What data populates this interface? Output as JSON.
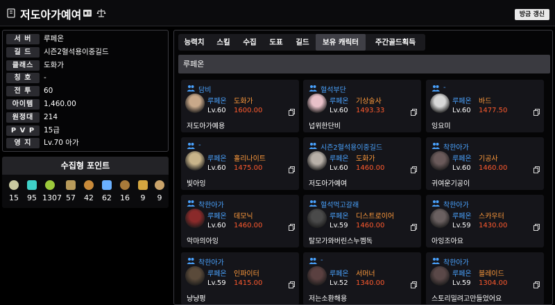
{
  "header": {
    "title": "저도아가예여",
    "refresh_label": "갱신",
    "refresh_prefix": "방금"
  },
  "info": {
    "rows": [
      {
        "key": "서 버",
        "value": "루페온"
      },
      {
        "key": "길 드",
        "value": "시즌2혈석용이중길드"
      },
      {
        "key": "클래스",
        "value": "도화가"
      },
      {
        "key": "칭 호",
        "value": "-"
      },
      {
        "key": "전 투",
        "value": "60"
      },
      {
        "key": "아이템",
        "value": "1,460.00"
      },
      {
        "key": "원정대",
        "value": "214"
      },
      {
        "key": "P V P",
        "value": "15급"
      },
      {
        "key": "영 지",
        "value": "Lv.70 아가"
      }
    ]
  },
  "collection": {
    "title": "수집형 포인트",
    "items": [
      {
        "icon": "mokoko-seed-icon",
        "value": "15",
        "color": "#c9c9a0"
      },
      {
        "icon": "island-heart-icon",
        "value": "95",
        "color": "#3fd1c8"
      },
      {
        "icon": "giant-heart-icon",
        "value": "1307",
        "color": "#9cc93b"
      },
      {
        "icon": "art-piece-icon",
        "value": "57",
        "color": "#b89a5a"
      },
      {
        "icon": "voyage-map-icon",
        "value": "42",
        "color": "#c98a3a"
      },
      {
        "icon": "igneas-token-icon",
        "value": "62",
        "color": "#6ab0ff"
      },
      {
        "icon": "world-tree-leaf-icon",
        "value": "16",
        "color": "#a87a3a"
      },
      {
        "icon": "orpheus-star-icon",
        "value": "9",
        "color": "#d4a640"
      },
      {
        "icon": "orpheus-medal-icon",
        "value": "9",
        "color": "#c9a36a"
      }
    ]
  },
  "tabs": [
    {
      "label": "능력치",
      "active": false
    },
    {
      "label": "스킬",
      "active": false
    },
    {
      "label": "수집",
      "active": false
    },
    {
      "label": "도표",
      "active": false
    },
    {
      "label": "길드",
      "active": false
    },
    {
      "label": "보유 캐릭터",
      "active": true
    },
    {
      "label": "주간골드획득",
      "active": false
    }
  ],
  "server_header": "루페온",
  "characters": [
    {
      "guild": "담비",
      "server": "루페온",
      "class": "도화가",
      "level": "Lv.60",
      "ilvl": "1600.00",
      "name": "저도아가예용",
      "avatar_color": "#c9a98a"
    },
    {
      "guild": "혈석부단",
      "server": "루페온",
      "class": "기상술사",
      "level": "Lv.60",
      "ilvl": "1493.33",
      "name": "넙위한단비",
      "avatar_color": "#e8c0c8"
    },
    {
      "guild": "-",
      "server": "루페온",
      "class": "바드",
      "level": "Lv.60",
      "ilvl": "1477.50",
      "name": "잉요미",
      "avatar_color": "#d8d8d8"
    },
    {
      "guild": "-",
      "server": "루페온",
      "class": "홀리나이트",
      "level": "Lv.60",
      "ilvl": "1475.00",
      "name": "빛아잉",
      "avatar_color": "#c8b48a"
    },
    {
      "guild": "시즌2혈석용이중길드",
      "server": "루페온",
      "class": "도화가",
      "level": "Lv.60",
      "ilvl": "1460.00",
      "name": "저도아가예여",
      "avatar_color": "#b8b0a8"
    },
    {
      "guild": "착한아가",
      "server": "루페온",
      "class": "기공사",
      "level": "Lv.60",
      "ilvl": "1460.00",
      "name": "귀여운기공이",
      "avatar_color": "#6a5a5a"
    },
    {
      "guild": "착한아가",
      "server": "루페온",
      "class": "데모닉",
      "level": "Lv.60",
      "ilvl": "1460.00",
      "name": "악마의아잉",
      "avatar_color": "#8a2a2a"
    },
    {
      "guild": "혈석먹고갈래",
      "server": "루페온",
      "class": "디스트로이어",
      "level": "Lv.59",
      "ilvl": "1460.00",
      "name": "탈모가와버린스누껨독",
      "avatar_color": "#4a4a4a"
    },
    {
      "guild": "착한아가",
      "server": "루페온",
      "class": "스카우터",
      "level": "Lv.59",
      "ilvl": "1430.00",
      "name": "아잉조아요",
      "avatar_color": "#6a6060"
    },
    {
      "guild": "착한아가",
      "server": "루페온",
      "class": "인파이터",
      "level": "Lv.59",
      "ilvl": "1415.00",
      "name": "냥냥펑",
      "avatar_color": "#5a4a3a"
    },
    {
      "guild": "-",
      "server": "루페온",
      "class": "서머너",
      "level": "Lv.52",
      "ilvl": "1340.00",
      "name": "저는소환해용",
      "avatar_color": "#5a4040"
    },
    {
      "guild": "착한아가",
      "server": "루페온",
      "class": "블레이드",
      "level": "Lv.59",
      "ilvl": "1304.00",
      "name": "스토리밀려고만들었어요",
      "avatar_color": "#5a4848"
    }
  ],
  "colors": {
    "accent_blue": "#4aa3ff",
    "class_orange": "#ff9a3c",
    "ilvl_red": "#ff5a2e"
  }
}
